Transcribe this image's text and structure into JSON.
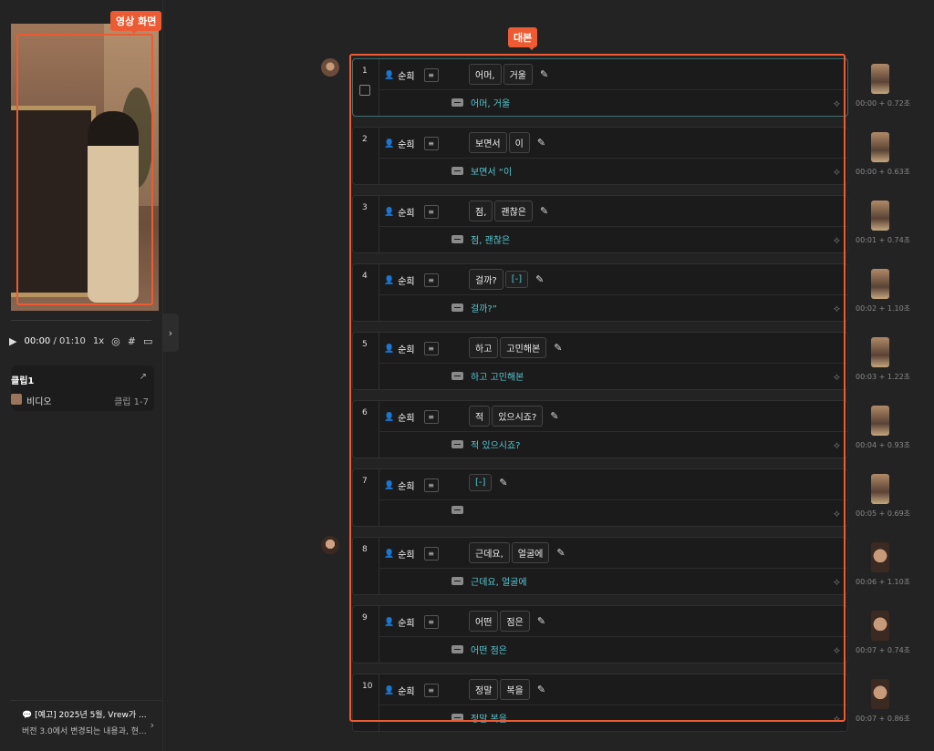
{
  "annotations": {
    "video_callout": "영상 화면",
    "script_callout": "대본",
    "accent_color": "#ec5b33"
  },
  "player": {
    "current_time": "00:00",
    "total_time": "/ 01:10",
    "speed": "1x"
  },
  "clip": {
    "title": "클립1",
    "track_label": "비디오",
    "range": "클립 1-7"
  },
  "notice": {
    "title": "[예고] 2025년 5월, Vrew가 ...",
    "subtitle": "버전 3.0에서 변경되는 내용과, 현..."
  },
  "rows": [
    {
      "num": "1",
      "speaker": "순희",
      "words": [
        "어머,",
        "거울"
      ],
      "caption": "어머, 거울",
      "time": "00:00 + 0.72초"
    },
    {
      "num": "2",
      "speaker": "순희",
      "words": [
        "보면서",
        "이"
      ],
      "caption": "보면서 “이",
      "time": "00:00 + 0.63초"
    },
    {
      "num": "3",
      "speaker": "순희",
      "words": [
        "점,",
        "괜찮은"
      ],
      "caption": "점, 괜찮은",
      "time": "00:01 + 0.74초"
    },
    {
      "num": "4",
      "speaker": "순희",
      "words": [
        "걸까?",
        "[-]"
      ],
      "caption": "걸까?”",
      "time": "00:02 + 1.10초"
    },
    {
      "num": "5",
      "speaker": "순희",
      "words": [
        "하고",
        "고민해본"
      ],
      "caption": "하고 고민해본",
      "time": "00:03 + 1.22초"
    },
    {
      "num": "6",
      "speaker": "순희",
      "words": [
        "적",
        "있으시죠?"
      ],
      "caption": "적 있으시죠?",
      "time": "00:04 + 0.93초"
    },
    {
      "num": "7",
      "speaker": "순희",
      "words": [
        "[-]"
      ],
      "caption": "",
      "time": "00:05 + 0.69초"
    },
    {
      "num": "8",
      "speaker": "순희",
      "words": [
        "근데요,",
        "얼굴에"
      ],
      "caption": "근데요, 얼굴에",
      "time": "00:06 + 1.10초"
    },
    {
      "num": "9",
      "speaker": "순희",
      "words": [
        "어떤",
        "점은"
      ],
      "caption": "어떤 점은",
      "time": "00:07 + 0.74초"
    },
    {
      "num": "10",
      "speaker": "순희",
      "words": [
        "정말",
        "복을"
      ],
      "caption": "정말 복을",
      "time": "00:07 + 0.86초"
    }
  ]
}
